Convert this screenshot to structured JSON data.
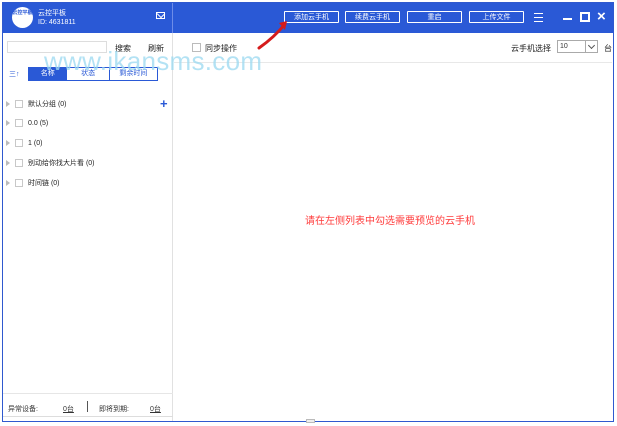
{
  "app": {
    "logo_text": "云控平板",
    "title": "云控平板",
    "id_text": "ID: 4631811",
    "colors": {
      "header": "#2a59d6",
      "accent": "#2a59d6",
      "notice": "#ff3b3b",
      "watermark": "#9edbf1"
    },
    "icons": {
      "mail": "mail-icon",
      "menu": "menu-icon",
      "minimize": "minimize-icon",
      "maximize": "maximize-icon",
      "close": "close-icon"
    }
  },
  "top_buttons": {
    "add_cloud_phone": "添加云手机",
    "renew_cloud_phone": "续费云手机",
    "restart": "重启",
    "upload_file": "上传文件"
  },
  "sidebar": {
    "search_placeholder": "",
    "search": "搜索",
    "refresh": "刷新",
    "sort_icon": "三↑",
    "tabs": [
      {
        "label": "名称",
        "active": true
      },
      {
        "label": "状态",
        "active": false
      },
      {
        "label": "剩余时间",
        "active": false
      }
    ],
    "groups": [
      {
        "name": "默认分组",
        "count": "(0)"
      },
      {
        "name": "0.0",
        "count": "(5)"
      },
      {
        "name": "1",
        "count": "(0)"
      },
      {
        "name": "别动给你找大片看",
        "count": "(0)"
      },
      {
        "name": "时间链",
        "count": "(0)"
      }
    ],
    "footer": {
      "abnormal_label": "异常设备:",
      "abnormal_value": "0台",
      "expiring_label": "即将到期:",
      "expiring_value": "0台"
    }
  },
  "main": {
    "sync_label": "同步操作",
    "phone_select_label": "云手机选择",
    "phone_select_value": "10",
    "unit": "台",
    "notice": "请在左侧列表中勾选需要预览的云手机"
  },
  "watermark": "www.ikansms.com"
}
